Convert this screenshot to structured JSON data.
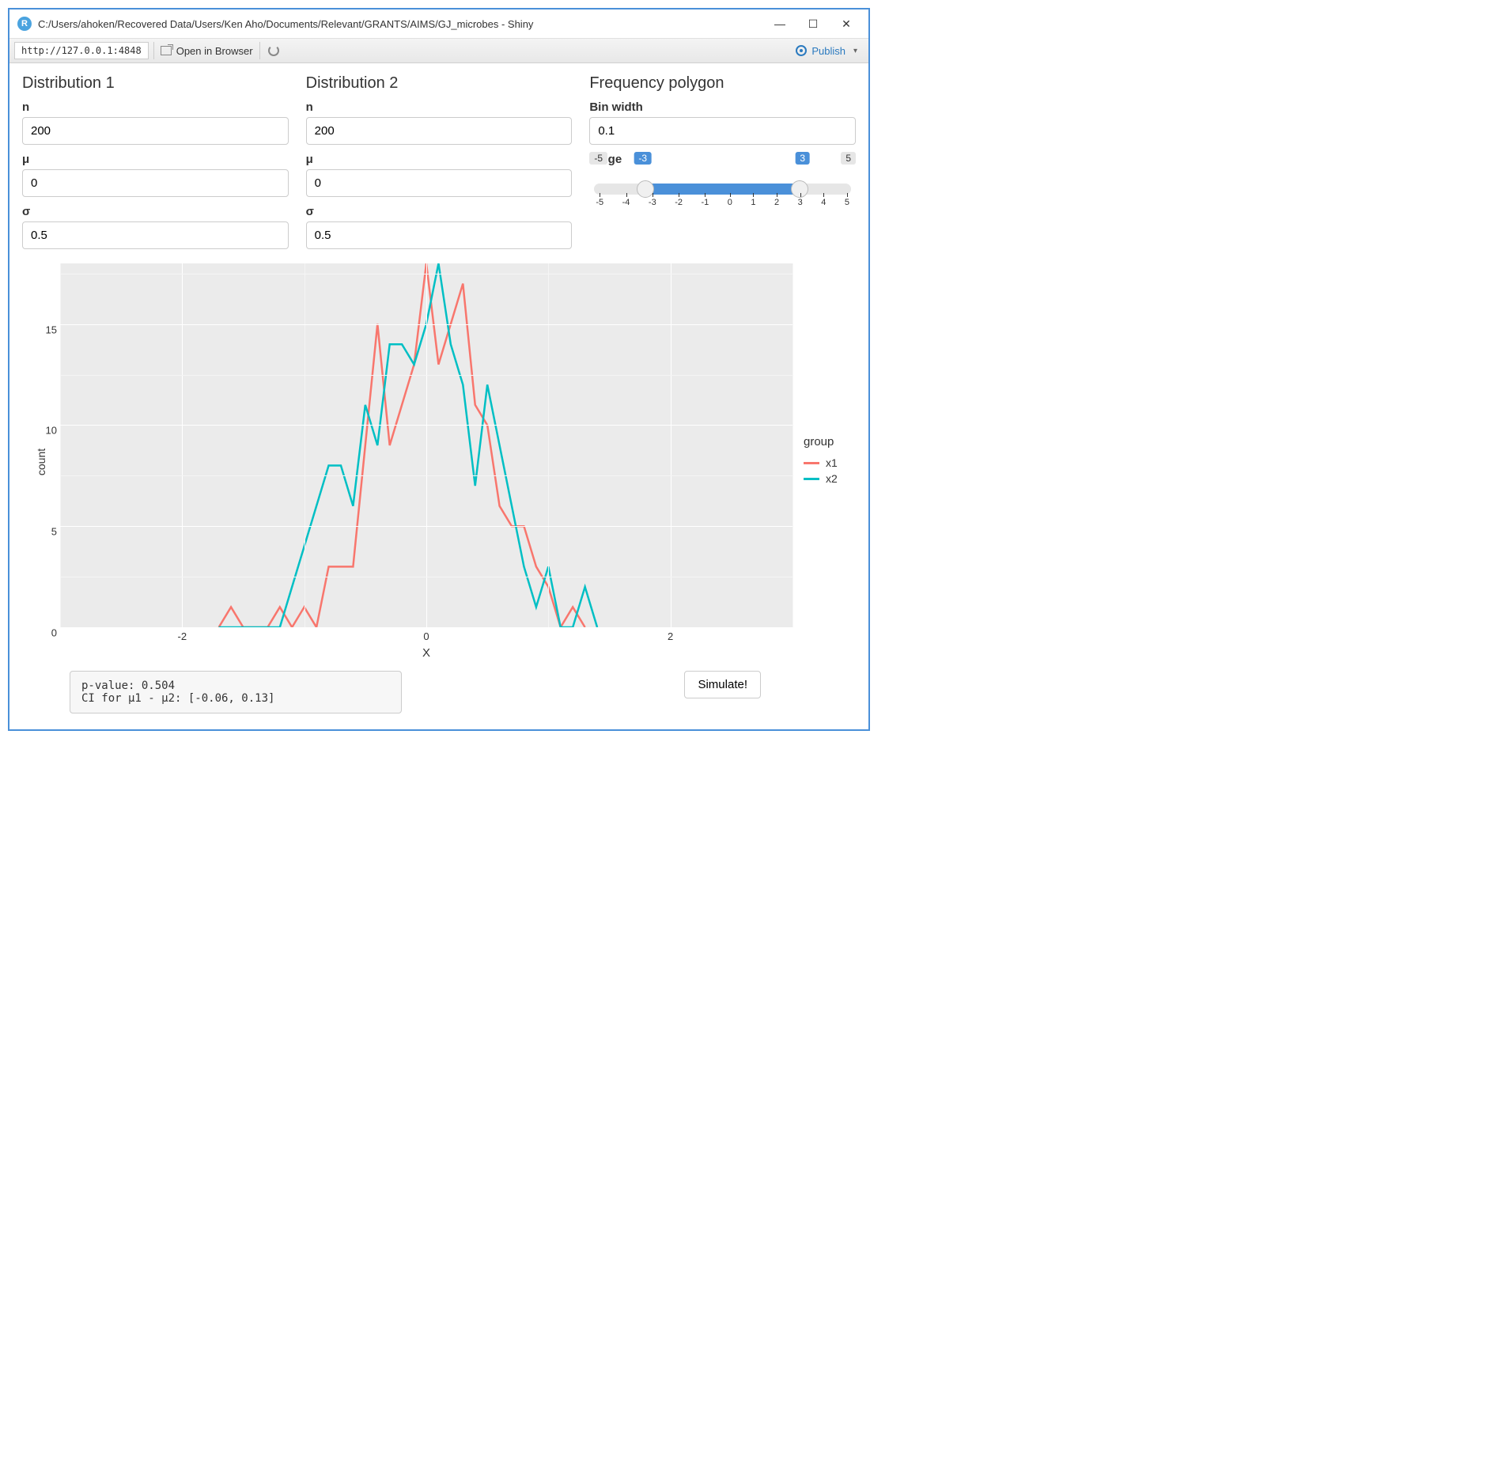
{
  "window": {
    "app_letter": "R",
    "title": "C:/Users/ahoken/Recovered Data/Users/Ken Aho/Documents/Relevant/GRANTS/AIMS/GJ_microbes - Shiny"
  },
  "toolbar": {
    "address": "http://127.0.0.1:4848",
    "open_label": "Open in Browser",
    "publish_label": "Publish"
  },
  "dist1": {
    "heading": "Distribution 1",
    "n_label": "n",
    "n_value": "200",
    "mu_label": "μ",
    "mu_value": "0",
    "sigma_label": "σ",
    "sigma_value": "0.5"
  },
  "dist2": {
    "heading": "Distribution 2",
    "n_label": "n",
    "n_value": "200",
    "mu_label": "μ",
    "mu_value": "0",
    "sigma_label": "σ",
    "sigma_value": "0.5"
  },
  "freq": {
    "heading": "Frequency polygon",
    "bin_label": "Bin width",
    "bin_value": "0.1",
    "range_label": "range",
    "range_min": "-5",
    "range_max": "5",
    "range_lo": "-3",
    "range_hi": "3",
    "ticks": [
      "-5",
      "-4",
      "-3",
      "-2",
      "-1",
      "0",
      "1",
      "2",
      "3",
      "4",
      "5"
    ]
  },
  "chart_data": {
    "type": "line",
    "xlabel": "X",
    "ylabel": "count",
    "legend_title": "group",
    "xlim": [
      -3,
      3
    ],
    "ylim": [
      0,
      18
    ],
    "xticks": [
      -2,
      0,
      2
    ],
    "yticks": [
      0,
      5,
      10,
      15
    ],
    "colors": {
      "x1": "#f8766d",
      "x2": "#00bfc4"
    },
    "series": [
      {
        "name": "x1",
        "x": [
          -1.7,
          -1.6,
          -1.5,
          -1.4,
          -1.3,
          -1.2,
          -1.1,
          -1.0,
          -0.9,
          -0.8,
          -0.7,
          -0.6,
          -0.5,
          -0.4,
          -0.3,
          -0.2,
          -0.1,
          0.0,
          0.1,
          0.2,
          0.3,
          0.4,
          0.5,
          0.6,
          0.7,
          0.8,
          0.9,
          1.0,
          1.1,
          1.2,
          1.3
        ],
        "y": [
          0,
          1,
          0,
          0,
          0,
          1,
          0,
          1,
          0,
          3,
          3,
          3,
          9,
          15,
          9,
          11,
          13,
          18,
          13,
          15,
          17,
          11,
          10,
          6,
          5,
          5,
          3,
          2,
          0,
          1,
          0
        ]
      },
      {
        "name": "x2",
        "x": [
          -1.7,
          -1.6,
          -1.5,
          -1.4,
          -1.3,
          -1.2,
          -1.1,
          -1.0,
          -0.9,
          -0.8,
          -0.7,
          -0.6,
          -0.5,
          -0.4,
          -0.3,
          -0.2,
          -0.1,
          0.0,
          0.1,
          0.2,
          0.3,
          0.4,
          0.5,
          0.6,
          0.7,
          0.8,
          0.9,
          1.0,
          1.1,
          1.2,
          1.3,
          1.4
        ],
        "y": [
          0,
          0,
          0,
          0,
          0,
          0,
          2,
          4,
          6,
          8,
          8,
          6,
          11,
          9,
          14,
          14,
          13,
          15,
          18,
          14,
          12,
          7,
          12,
          9,
          6,
          3,
          1,
          3,
          0,
          0,
          2,
          0
        ]
      }
    ]
  },
  "results": {
    "line1": "p-value: 0.504",
    "line2": "CI for μ1 - μ2: [-0.06, 0.13]"
  },
  "buttons": {
    "simulate": "Simulate!"
  }
}
